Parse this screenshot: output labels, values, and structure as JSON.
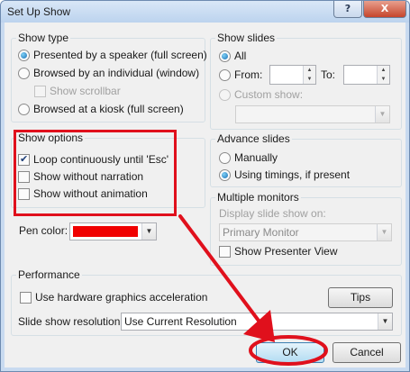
{
  "window": {
    "title": "Set Up Show",
    "help_glyph": "?",
    "close_glyph": "X"
  },
  "show_type": {
    "label": "Show type",
    "options": [
      {
        "label": "Presented by a speaker (full screen)",
        "selected": true
      },
      {
        "label": "Browsed by an individual (window)",
        "selected": false
      },
      {
        "label": "Show scrollbar",
        "checked": false,
        "disabled": true
      },
      {
        "label": "Browsed at a kiosk (full screen)",
        "selected": false
      }
    ]
  },
  "show_options": {
    "label": "Show options",
    "options": [
      {
        "label": "Loop continuously until 'Esc'",
        "checked": true
      },
      {
        "label": "Show without narration",
        "checked": false
      },
      {
        "label": "Show without animation",
        "checked": false
      }
    ]
  },
  "pen_color": {
    "label": "Pen color:",
    "value": "#f00000"
  },
  "show_slides": {
    "label": "Show slides",
    "all_label": "All",
    "from_label": "From:",
    "to_label": "To:",
    "from_value": "",
    "to_value": "",
    "custom_label": "Custom show:",
    "custom_value": ""
  },
  "advance_slides": {
    "label": "Advance slides",
    "manually_label": "Manually",
    "timings_label": "Using timings, if present"
  },
  "multiple_monitors": {
    "label": "Multiple monitors",
    "display_label": "Display slide show on:",
    "display_value": "Primary Monitor",
    "presenter_view_label": "Show Presenter View"
  },
  "performance": {
    "label": "Performance",
    "hw_accel_label": "Use hardware graphics acceleration",
    "tips_label": "Tips",
    "resolution_label": "Slide show resolution:",
    "resolution_value": "Use Current Resolution"
  },
  "footer": {
    "ok_label": "OK",
    "cancel_label": "Cancel"
  },
  "annotation_color": "#e0101c"
}
